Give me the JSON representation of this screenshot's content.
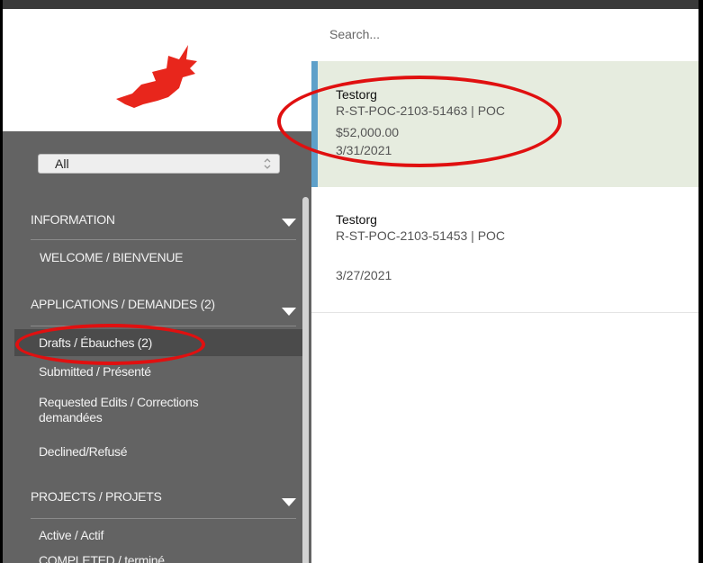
{
  "search": {
    "placeholder": "Search..."
  },
  "filter": {
    "selected": "All"
  },
  "sidebar": {
    "sections": [
      {
        "label": "INFORMATION",
        "items": [
          "WELCOME / BIENVENUE"
        ]
      },
      {
        "label": "APPLICATIONS / DEMANDES (2)",
        "items": [
          "Drafts / Ébauches  (2)",
          "Submitted / Présenté",
          "Requested Edits / Corrections",
          "demandées",
          "Declined/Refusé"
        ]
      },
      {
        "label": "PROJECTS / PROJETS",
        "items": [
          "Active / Actif",
          "COMPLETED / terminé"
        ]
      }
    ]
  },
  "records": [
    {
      "org": "Testorg",
      "ref": "R-ST-POC-2103-51463 | POC",
      "amount": "$52,000.00",
      "date": "3/31/2021"
    },
    {
      "org": "Testorg",
      "ref": "R-ST-POC-2103-51453 | POC",
      "amount": "",
      "date": "3/27/2021"
    }
  ],
  "colors": {
    "sidebar_bg": "#636363",
    "selected_bg": "#e6ecdf",
    "accent_bar": "#5ea0c9",
    "logo_red": "#e8261c",
    "annotation": "#e01010"
  }
}
